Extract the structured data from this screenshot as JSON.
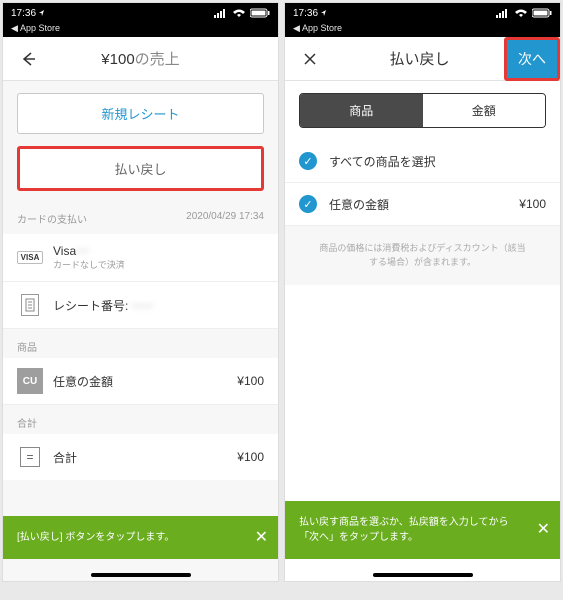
{
  "status": {
    "time": "17:36",
    "app_store": "App Store"
  },
  "left": {
    "nav": {
      "title_amount": "¥100",
      "title_suffix": "の売上"
    },
    "buttons": {
      "new_receipt": "新規レシート",
      "refund": "払い戻し"
    },
    "payment": {
      "section": "カードの支払い",
      "datetime": "2020/04/29 17:34",
      "visa_label": "Visa",
      "visa_masked": "•••",
      "visa_sub": "カードなしで決済",
      "receipt_label": "レシート番号:",
      "receipt_num": "•••••"
    },
    "items": {
      "head": "商品",
      "cu": "CU",
      "name": "任意の金額",
      "price": "¥100"
    },
    "total": {
      "head": "合計",
      "label": "合計",
      "value": "¥100"
    },
    "toast": "[払い戻し] ボタンをタップします。"
  },
  "right": {
    "nav": {
      "title": "払い戻し",
      "next": "次へ"
    },
    "segments": {
      "items": "商品",
      "amount": "金額"
    },
    "rows": {
      "select_all": "すべての商品を選択",
      "custom_amount": "任意の金額",
      "custom_value": "¥100"
    },
    "hint": "商品の価格には消費税およびディスカウント（該当する場合）が含まれます。",
    "toast": "払い戻す商品を選ぶか、払戻額を入力してから「次へ」をタップします。"
  }
}
